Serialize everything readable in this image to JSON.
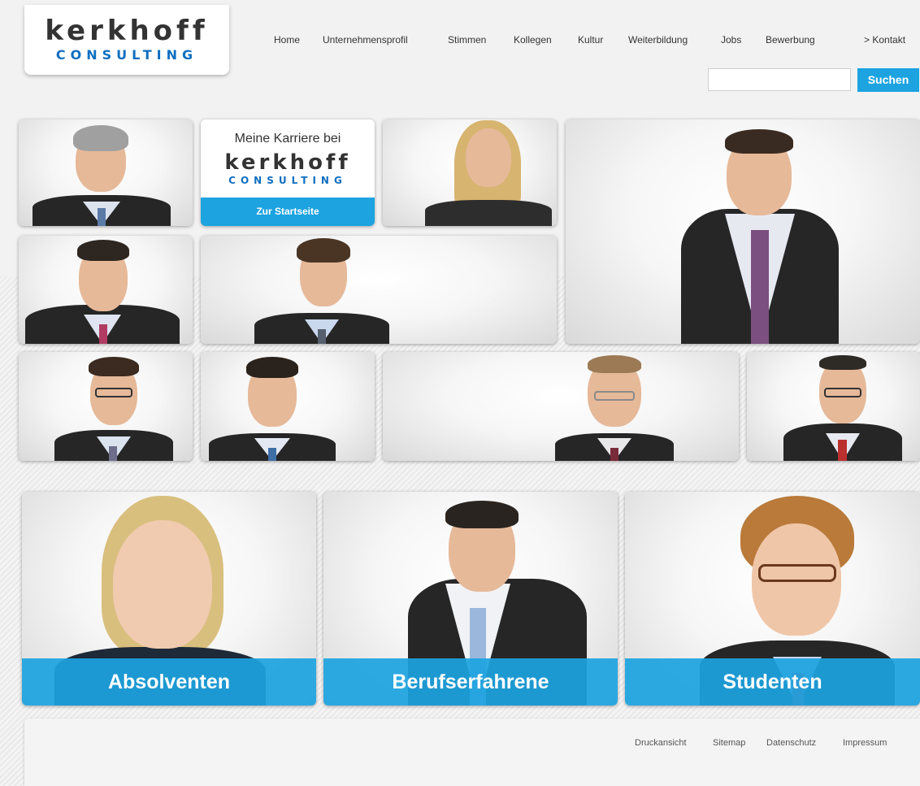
{
  "logo": {
    "main": "kerkhoff",
    "sub": "CONSULTING"
  },
  "nav": [
    "Home",
    "Unternehmensprofil",
    "Stimmen",
    "Kollegen",
    "Kultur",
    "Weiterbildung",
    "Jobs",
    "Bewerbung",
    "> Kontakt"
  ],
  "search": {
    "placeholder": "",
    "button_label": "Suchen"
  },
  "career": {
    "title": "Meine Karriere bei",
    "logo_main": "kerkhoff",
    "logo_sub": "CONSULTING",
    "button_label": "Zur Startseite"
  },
  "categories": [
    "Absolventen",
    "Berufserfahrene",
    "Studenten"
  ],
  "footer": [
    "Druckansicht",
    "Sitemap",
    "Datenschutz",
    "Impressum"
  ],
  "colors": {
    "accent": "#1ca3e0",
    "logo_blue": "#0f6fc0",
    "text": "#333333"
  }
}
